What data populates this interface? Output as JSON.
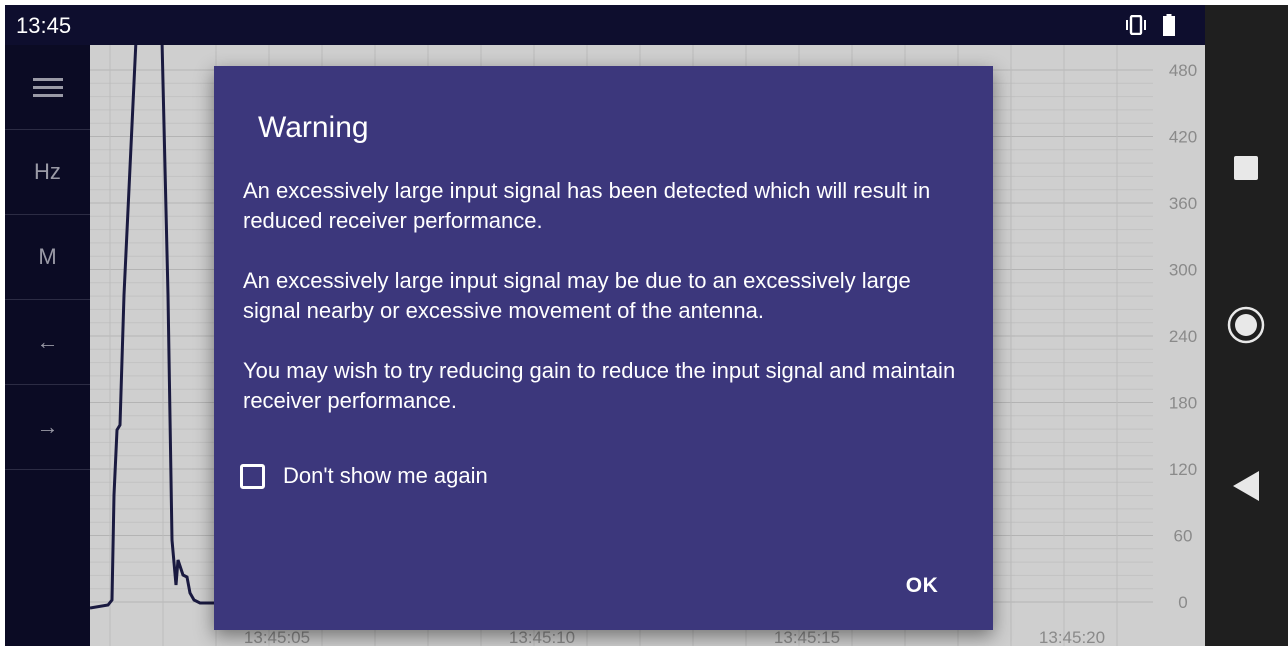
{
  "status_bar": {
    "time": "13:45",
    "icons": [
      "vibrate-icon",
      "battery-icon"
    ]
  },
  "side_menu": {
    "items": [
      {
        "icon": "hamburger-menu-icon",
        "label": ""
      },
      {
        "icon": "",
        "label": "Hz"
      },
      {
        "icon": "",
        "label": "M"
      },
      {
        "icon": "arrow-left-icon",
        "label": "←"
      },
      {
        "icon": "arrow-right-icon",
        "label": "→"
      }
    ]
  },
  "chart_data": {
    "type": "line",
    "y_ticks": [
      "480",
      "420",
      "360",
      "300",
      "240",
      "180",
      "120",
      "60",
      "0"
    ],
    "x_ticks": [
      "13:45:05",
      "13:45:10",
      "13:45:15",
      "13:45:20"
    ],
    "ylim": [
      0,
      480
    ],
    "series_color": "#1a1a40",
    "grid": true
  },
  "dialog": {
    "title": "Warning",
    "paragraphs": [
      "An excessively large input signal has been detected which will result in reduced receiver performance.",
      "An excessively large input signal may be due to an excessively large signal nearby or excessive movement of the antenna.",
      "You may wish to try reducing gain to reduce the input signal and maintain receiver performance."
    ],
    "checkbox_label": "Don't show me again",
    "checkbox_checked": false,
    "ok_label": "OK",
    "background": "#3c377c"
  },
  "nav_bar": {
    "icons": [
      "recents-square-icon",
      "home-circle-icon",
      "back-triangle-icon"
    ]
  }
}
